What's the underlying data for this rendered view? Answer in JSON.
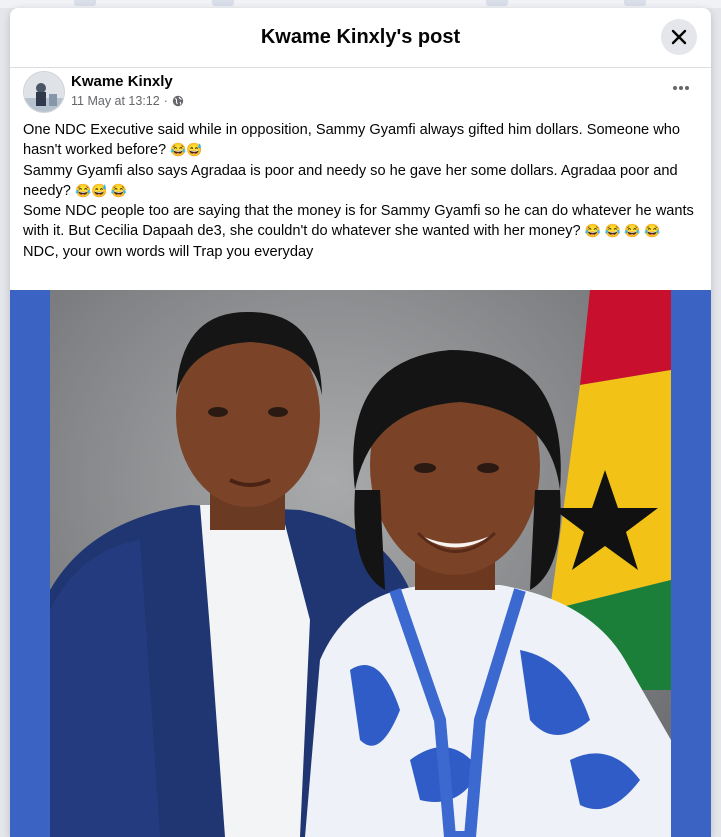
{
  "modal": {
    "title": "Kwame Kinxly's post"
  },
  "post": {
    "author": "Kwame Kinxly",
    "timestamp": "11 May at 13:12",
    "separator": "·",
    "audience_icon": "globe-icon",
    "paragraphs": [
      {
        "text": "One NDC Executive said while in opposition, Sammy Gyamfi always gifted him dollars. Someone who hasn't worked before? ",
        "emoji": "😂😅"
      },
      {
        "text": "Sammy Gyamfi also says Agradaa is poor and needy so he gave her some dollars. Agradaa poor and needy? ",
        "emoji": "😂😅 😂"
      },
      {
        "text": "Some NDC people too are saying that the money is for Sammy Gyamfi so he can do whatever he wants with it. But Cecilia Dapaah de3, she couldn't do whatever she wanted with her money? ",
        "emoji": "😂 😂 😂 😂"
      },
      {
        "text": "NDC, your own words will Trap you everyday",
        "emoji": ""
      }
    ]
  },
  "colors": {
    "accent_frame": "#3a63c4",
    "text_primary": "#050505",
    "text_secondary": "#65676b"
  }
}
